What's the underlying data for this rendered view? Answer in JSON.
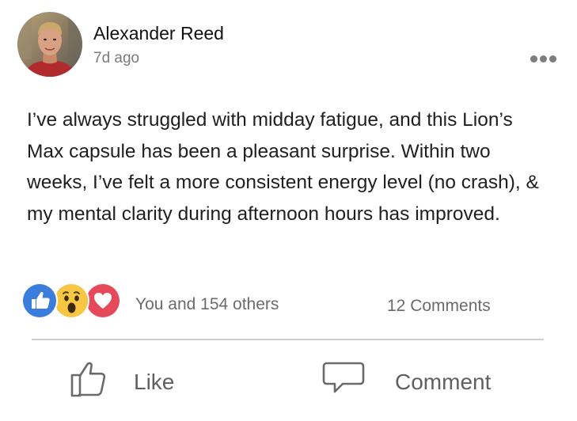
{
  "post": {
    "author": "Alexander Reed",
    "time": "7d ago",
    "body_lines": [
      "I’ve always struggled with midday fatigue, and this Lion’s",
      "Max capsule has been a pleasant surprise. Within two",
      "weeks, I’ve felt a more consistent energy level (no crash), &",
      "my mental clarity during afternoon hours has improved."
    ]
  },
  "reactions": {
    "icons": [
      "like-icon",
      "wow-icon",
      "love-icon"
    ],
    "colors": {
      "like": "#3b7ddd",
      "wow": "#f7c744",
      "love": "#e64a5a"
    },
    "summary": "You and 154 others"
  },
  "comments": {
    "count_label": "12 Comments"
  },
  "actions": {
    "like_label": "Like",
    "comment_label": "Comment"
  }
}
